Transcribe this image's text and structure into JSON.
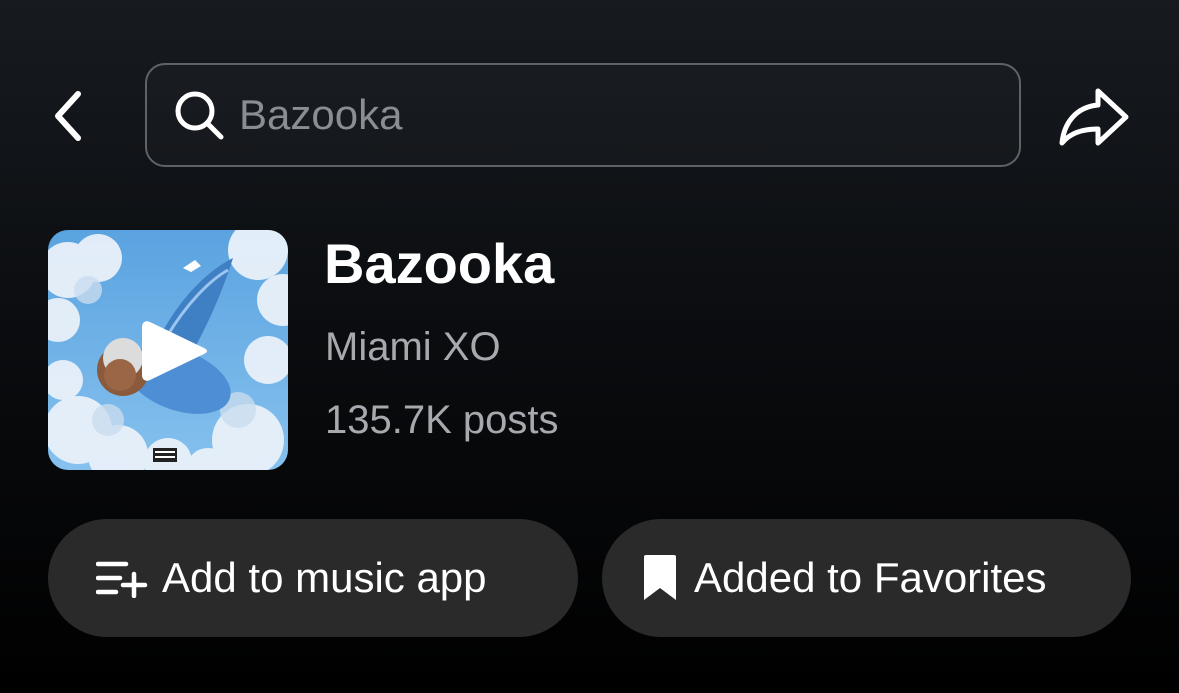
{
  "header": {
    "back_icon": "chevron-left-icon",
    "search": {
      "value": "Bazooka",
      "icon": "search-icon"
    },
    "share_icon": "share-arrow-icon"
  },
  "track": {
    "title": "Bazooka",
    "artist": "Miami XO",
    "posts": "135.7K posts",
    "cover_play_icon": "play-icon"
  },
  "actions": {
    "add_to_music_app": {
      "label": "Add to music app",
      "icon": "playlist-add-icon"
    },
    "favorites": {
      "label": "Added to Favorites",
      "icon": "bookmark-filled-icon"
    }
  },
  "colors": {
    "background": "#000000",
    "text_primary": "#ffffff",
    "text_secondary": "#a6a9ad",
    "placeholder": "#8a8e94",
    "pill_background": "#2a2a2a",
    "search_border": "#5f6368"
  }
}
